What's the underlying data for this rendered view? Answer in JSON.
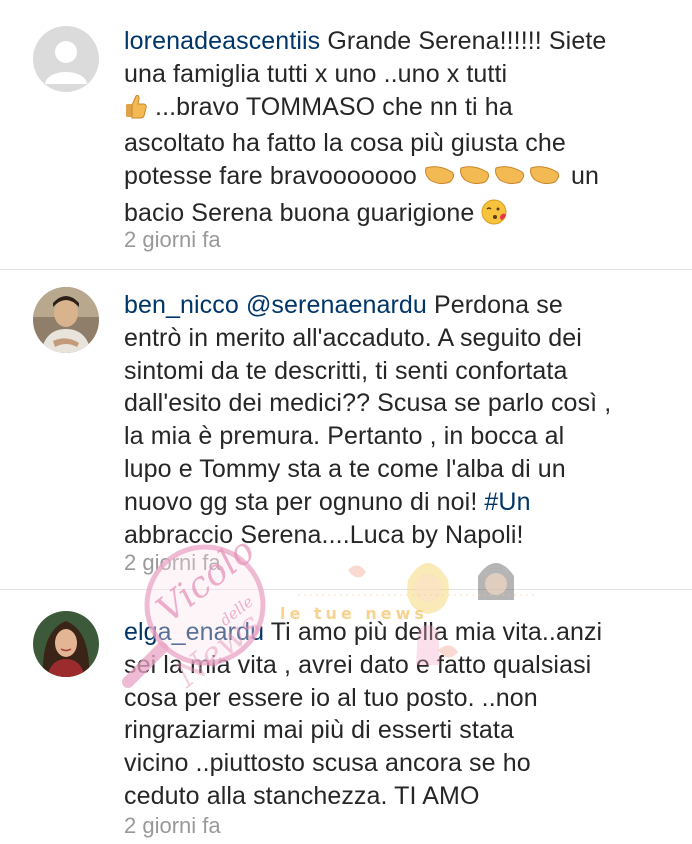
{
  "comments": [
    {
      "username": "lorenadeascentiis",
      "text_1": " Grande Serena!!!!!! Siete",
      "text_2": "una famiglia tutti x uno ..uno x tutti",
      "text_3": " ...bravo TOMMASO che nn ti ha",
      "text_4": "ascoltato ha fatto la cosa più  giusta che",
      "text_5": "potesse fare bravooooooo ",
      "text_5b": " un",
      "text_6": "bacio Serena buona guarigione ",
      "time": "2 giorni fa",
      "avatar": "default-avatar-icon"
    },
    {
      "username": "ben_nicco",
      "mention": "@serenaenardu",
      "text_1": " Perdona se",
      "text_2": "entrò in merito all'accaduto. A seguito dei",
      "text_3": "sintomi da te descritti, ti senti confortata",
      "text_4": "dall'esito dei medici?? Scusa se parlo così ,",
      "text_5": "la mia è premura. Pertanto , in bocca al",
      "text_6": "lupo e Tommy sta a te come l'alba di un",
      "text_7": "nuovo gg sta per ognuno di noi! ",
      "hashtag": "#Un",
      "text_8": "abbraccio Serena....Luca by Napoli!",
      "time": "2 giorni fa",
      "avatar": "profile-photo"
    },
    {
      "username": "elga_enardu",
      "text_1": " Ti amo più della mia vita..anzi",
      "text_2": "sei la mia vita , avrei dato e fatto qualsiasi",
      "text_3": "cosa per essere io al tuo posto. ..non",
      "text_4": "ringraziarmi mai più di esserti stata",
      "text_5": "vicino ..piuttosto scusa ancora se ho",
      "text_6": "ceduto alla stanchezza.  TI AMO",
      "time": "2 giorni fa",
      "avatar": "profile-photo"
    }
  ],
  "watermark": {
    "line1": "Vicolo",
    "line2": "delle",
    "line3": "News",
    "banner": "le tue news"
  },
  "colors": {
    "username": "#003569",
    "timestamp": "#999999",
    "text": "#262626"
  }
}
